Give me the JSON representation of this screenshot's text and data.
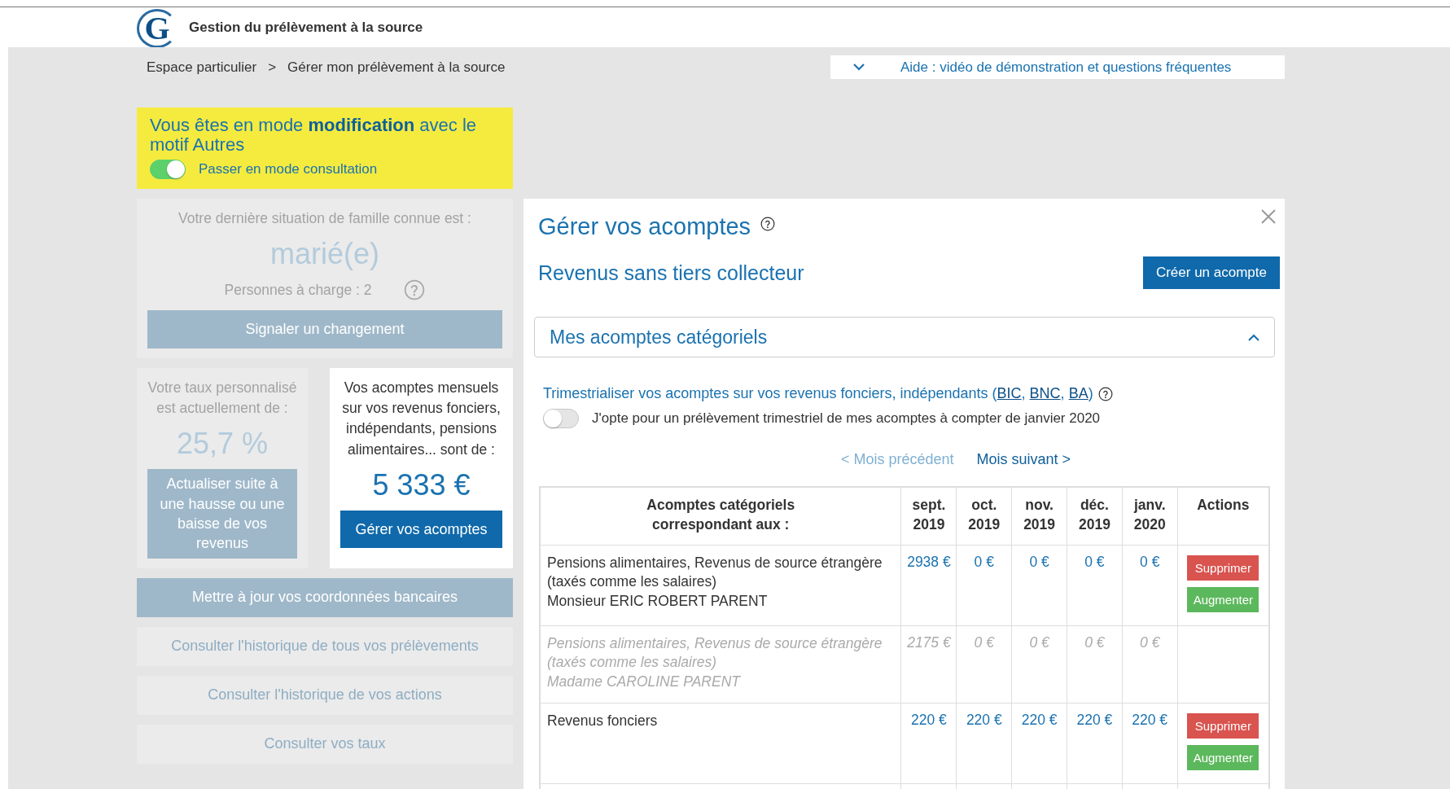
{
  "header": {
    "logo_letter": "G",
    "title": "Gestion du prélèvement à la source"
  },
  "breadcrumb": {
    "items": [
      "Espace particulier",
      "Gérer mon prélèvement à la source"
    ],
    "separator": ">"
  },
  "help": {
    "label": "Aide : vidéo de démonstration et questions fréquentes",
    "expanded": false
  },
  "mode_banner": {
    "text": "Vous êtes en mode **modification** avec le motif Autres",
    "toggle": {
      "label": "Passer en mode consultation",
      "on": true
    }
  },
  "family": {
    "intro": "Votre dernière situation de famille connue est :",
    "status": "marié(e)",
    "dependents": "Personnes à charge : 2",
    "button": {
      "label": "Signaler un changement",
      "disabled": true
    }
  },
  "rate": {
    "intro": "Votre taux personnalisé est actuellement de :",
    "value": "25,7 %",
    "button": {
      "label": "Actualiser suite à une hausse ou une baisse de vos revenus",
      "disabled": true
    }
  },
  "installments": {
    "intro": "Vos acomptes mensuels sur vos revenus fonciers, indépendants, pensions alimentaires... sont de :",
    "amount": "5 333 €",
    "button": {
      "label": "Gérer vos acomptes",
      "disabled": false
    }
  },
  "left_links": [
    {
      "label": "Mettre à jour vos coordonnées bancaires",
      "kind": "primary"
    },
    {
      "label": "Consulter l'historique de tous vos prélèvements",
      "kind": "plain"
    },
    {
      "label": "Consulter l'historique de vos actions",
      "kind": "plain"
    },
    {
      "label": "Consulter vos taux",
      "kind": "plain"
    }
  ],
  "panel": {
    "title": "Gérer vos acomptes",
    "subtitle": "Revenus sans tiers collecteur",
    "create_button": "Créer un acompte",
    "accordion": {
      "title": "Mes acomptes catégoriels",
      "expanded": true
    },
    "quarterly": {
      "segments": [
        {
          "text": "Trimestrialiser vos acomptes sur vos revenus fonciers, indépendants (",
          "link": false
        },
        {
          "text": "BIC",
          "link": true
        },
        {
          "text": ", ",
          "link": false
        },
        {
          "text": "BNC",
          "link": true
        },
        {
          "text": ", ",
          "link": false
        },
        {
          "text": "BA",
          "link": true
        },
        {
          "text": ")",
          "link": false
        }
      ],
      "toggle": {
        "label": "J'opte pour un prélèvement trimestriel de mes acomptes à compter de janvier 2020",
        "on": false
      }
    },
    "nav": [
      {
        "label": "< Mois précédent",
        "disabled": true
      },
      {
        "label": "Mois suivant >",
        "disabled": false
      }
    ],
    "table": {
      "columns": [
        "Acomptes catégoriels\ncorrespondant aux :",
        "sept.\n2019",
        "oct.\n2019",
        "nov.\n2019",
        "déc.\n2019",
        "janv.\n2020",
        "Actions"
      ],
      "rows": [
        {
          "kind": "active",
          "lines": [
            "Pensions alimentaires, Revenus de source étrangère (taxés comme les salaires)",
            "Monsieur ERIC ROBERT PARENT"
          ],
          "values": [
            "2938 €",
            "0 €",
            "0 €",
            "0 €",
            "0 €"
          ],
          "actions": [
            {
              "label": "Supprimer",
              "kind": "delete"
            },
            {
              "label": "Augmenter",
              "kind": "increase"
            }
          ]
        },
        {
          "kind": "inactive",
          "lines": [
            "Pensions alimentaires, Revenus de source étrangère (taxés comme les salaires)",
            "Madame CAROLINE PARENT"
          ],
          "values": [
            "2175 €",
            "0 €",
            "0 €",
            "0 €",
            "0 €"
          ],
          "actions": []
        },
        {
          "kind": "active",
          "lines": [
            "Revenus fonciers"
          ],
          "values": [
            "220 €",
            "220 €",
            "220 €",
            "220 €",
            "220 €"
          ],
          "actions": [
            {
              "label": "Supprimer",
              "kind": "delete"
            },
            {
              "label": "Augmenter",
              "kind": "increase"
            }
          ]
        }
      ]
    }
  }
}
